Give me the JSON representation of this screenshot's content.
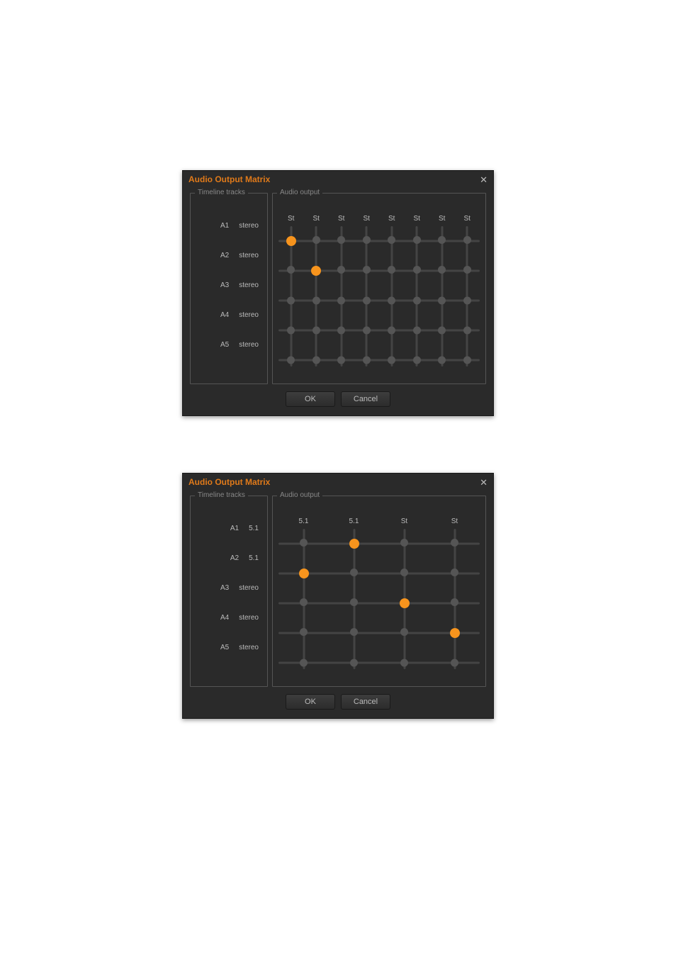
{
  "dialogs": [
    {
      "title": "Audio Output Matrix",
      "tracks_legend": "Timeline tracks",
      "output_legend": "Audio output",
      "tracks": [
        {
          "id": "A1",
          "type": "stereo"
        },
        {
          "id": "A2",
          "type": "stereo"
        },
        {
          "id": "A3",
          "type": "stereo"
        },
        {
          "id": "A4",
          "type": "stereo"
        },
        {
          "id": "A5",
          "type": "stereo"
        }
      ],
      "cols": [
        "St",
        "St",
        "St",
        "St",
        "St",
        "St",
        "St",
        "St"
      ],
      "active": [
        [
          0,
          0
        ],
        [
          1,
          1
        ]
      ],
      "ok": "OK",
      "cancel": "Cancel"
    },
    {
      "title": "Audio Output Matrix",
      "tracks_legend": "Timeline tracks",
      "output_legend": "Audio output",
      "tracks": [
        {
          "id": "A1",
          "type": "5.1"
        },
        {
          "id": "A2",
          "type": "5.1"
        },
        {
          "id": "A3",
          "type": "stereo"
        },
        {
          "id": "A4",
          "type": "stereo"
        },
        {
          "id": "A5",
          "type": "stereo"
        }
      ],
      "cols": [
        "5.1",
        "5.1",
        "St",
        "St"
      ],
      "active": [
        [
          0,
          1
        ],
        [
          1,
          0
        ],
        [
          2,
          2
        ],
        [
          3,
          3
        ]
      ],
      "ok": "OK",
      "cancel": "Cancel"
    }
  ]
}
